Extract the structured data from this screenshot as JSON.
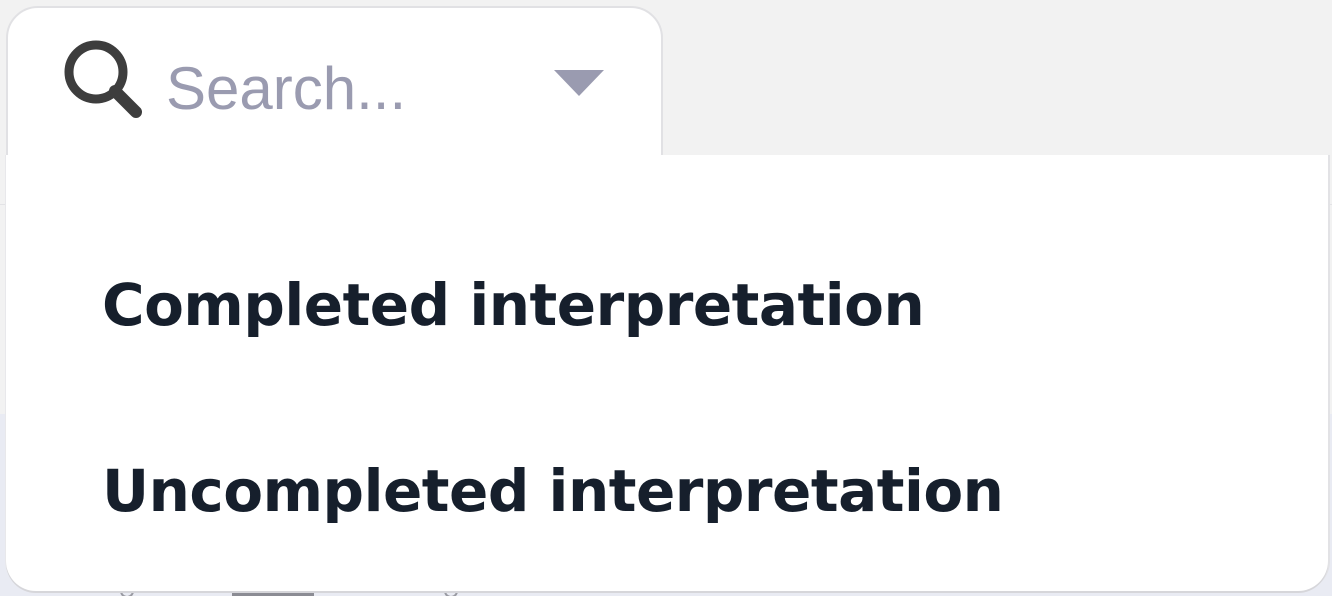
{
  "search": {
    "placeholder": "Search...",
    "value": ""
  },
  "dropdown": {
    "items": [
      {
        "label": "Completed interpretation"
      },
      {
        "label": "Uncompleted interpretation"
      }
    ]
  },
  "icons": {
    "search": "search-icon",
    "dropdown_toggle": "chevron-down-icon"
  },
  "colors": {
    "placeholder": "#9a9bb0",
    "icon": "#3d3d3d",
    "menu_text": "#161f2c",
    "background": "#f2f2f2",
    "surface": "#ffffff"
  }
}
